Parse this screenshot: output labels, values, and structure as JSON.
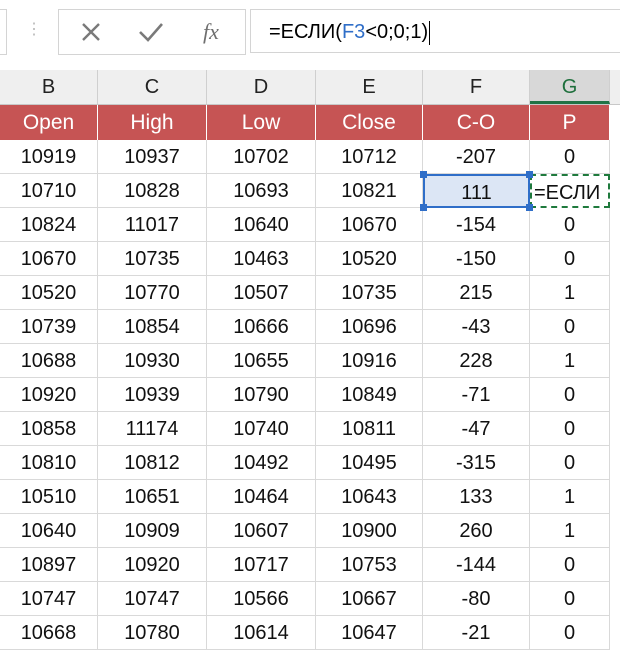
{
  "formula_bar": {
    "more_icon": "⋮",
    "cancel_icon": "close-icon",
    "enter_icon": "check-icon",
    "fx_label": "fx",
    "formula_prefix": "=ЕСЛИ(",
    "formula_ref": "F3",
    "formula_suffix": "<0;0;1)"
  },
  "columns": [
    "B",
    "C",
    "D",
    "E",
    "F",
    "G"
  ],
  "active_column": "G",
  "headers": [
    "Open",
    "High",
    "Low",
    "Close",
    "C-O",
    "P"
  ],
  "rows": [
    [
      "10919",
      "10937",
      "10702",
      "10712",
      "-207",
      "0"
    ],
    [
      "10710",
      "10828",
      "10693",
      "10821",
      "111",
      "=ЕСЛИ"
    ],
    [
      "10824",
      "11017",
      "10640",
      "10670",
      "-154",
      "0"
    ],
    [
      "10670",
      "10735",
      "10463",
      "10520",
      "-150",
      "0"
    ],
    [
      "10520",
      "10770",
      "10507",
      "10735",
      "215",
      "1"
    ],
    [
      "10739",
      "10854",
      "10666",
      "10696",
      "-43",
      "0"
    ],
    [
      "10688",
      "10930",
      "10655",
      "10916",
      "228",
      "1"
    ],
    [
      "10920",
      "10939",
      "10790",
      "10849",
      "-71",
      "0"
    ],
    [
      "10858",
      "11174",
      "10740",
      "10811",
      "-47",
      "0"
    ],
    [
      "10810",
      "10812",
      "10492",
      "10495",
      "-315",
      "0"
    ],
    [
      "10510",
      "10651",
      "10464",
      "10643",
      "133",
      "1"
    ],
    [
      "10640",
      "10909",
      "10607",
      "10900",
      "260",
      "1"
    ],
    [
      "10897",
      "10920",
      "10717",
      "10753",
      "-144",
      "0"
    ],
    [
      "10747",
      "10747",
      "10566",
      "10667",
      "-80",
      "0"
    ],
    [
      "10668",
      "10780",
      "10614",
      "10647",
      "-21",
      "0"
    ]
  ],
  "colors": {
    "header_bg": "#c65454",
    "header_text": "#ffffff",
    "ref_highlight": "#2f6ec8",
    "edit_border": "#1f7a3d"
  }
}
